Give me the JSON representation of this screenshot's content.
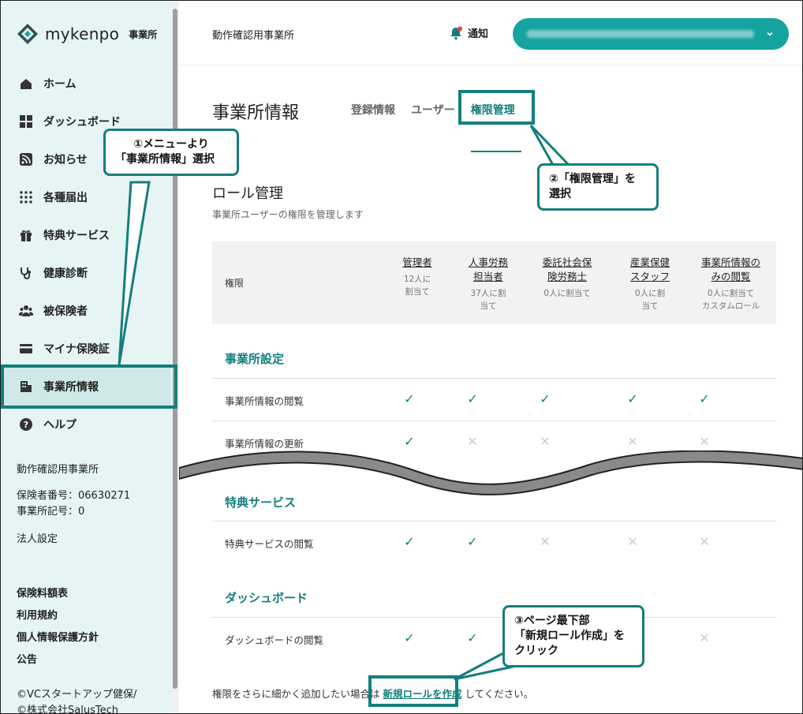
{
  "sidebar": {
    "logo": {
      "name": "mykenpo",
      "sub": "事業所"
    },
    "items": [
      {
        "label": "ホーム",
        "icon": "home-icon"
      },
      {
        "label": "ダッシュボード",
        "icon": "dashboard-icon"
      },
      {
        "label": "お知らせ",
        "icon": "rss-icon"
      },
      {
        "label": "各種届出",
        "icon": "grid-dots-icon"
      },
      {
        "label": "特典サービス",
        "icon": "gift-icon"
      },
      {
        "label": "健康診断",
        "icon": "stethoscope-icon"
      },
      {
        "label": "被保険者",
        "icon": "people-icon"
      },
      {
        "label": "マイナ保険証",
        "icon": "card-icon"
      },
      {
        "label": "事業所情報",
        "icon": "building-icon"
      },
      {
        "label": "ヘルプ",
        "icon": "help-icon"
      }
    ],
    "org_name": "動作確認用事業所",
    "insurer_no": "保険者番号：06630271",
    "office_symbol": "事業所記号：0",
    "corp_settings": "法人設定",
    "links": [
      "保険料額表",
      "利用規約",
      "個人情報保護方針",
      "公告"
    ],
    "copyright1": "©VCスタートアップ健保/",
    "copyright2": "©株式会社SalusTech"
  },
  "topbar": {
    "org_name": "動作確認用事業所",
    "notify_label": "通知"
  },
  "page": {
    "title": "事業所情報",
    "tabs": [
      "登録情報",
      "ユーザー",
      "権限管理"
    ],
    "section_title": "ロール管理",
    "section_desc": "事業所ユーザーの権限を管理します"
  },
  "table": {
    "header_label": "権限",
    "columns": [
      {
        "name1": "管理者",
        "name2": "",
        "sub1": "12人に",
        "sub2": "割当て",
        "sub3": ""
      },
      {
        "name1": "人事労務",
        "name2": "担当者",
        "sub1": "37人に割",
        "sub2": "当て",
        "sub3": ""
      },
      {
        "name1": "委託社会保",
        "name2": "険労務士",
        "sub1": "0人に割当て",
        "sub2": "",
        "sub3": ""
      },
      {
        "name1": "産業保健",
        "name2": "スタッフ",
        "sub1": "0人に割",
        "sub2": "当て",
        "sub3": ""
      },
      {
        "name1": "事業所情報の",
        "name2": "みの閲覧",
        "sub1": "0人に割当て",
        "sub2": "カスタムロール",
        "sub3": ""
      }
    ],
    "groups": [
      {
        "title": "事業所設定"
      },
      {
        "title": "特典サービス"
      },
      {
        "title": "ダッシュボード"
      }
    ],
    "rows": [
      {
        "label": "事業所情報の閲覧"
      },
      {
        "label": "事業所情報の更新"
      },
      {
        "label": "特典サービスの閲覧"
      },
      {
        "label": "ダッシュボードの閲覧"
      }
    ]
  },
  "footer": {
    "pre": "権限をさらに細かく追加したい場合は",
    "link": "新規ロールを作成",
    "post": "してください。"
  },
  "annotations": {
    "a1_line1": "①メニューより",
    "a1_line2": "「事業所情報」選択",
    "a2_line1": "②「権限管理」を",
    "a2_line2": "選択",
    "a3_line1": "③ページ最下部",
    "a3_line2": "「新規ロール作成」を",
    "a3_line3": "クリック"
  }
}
